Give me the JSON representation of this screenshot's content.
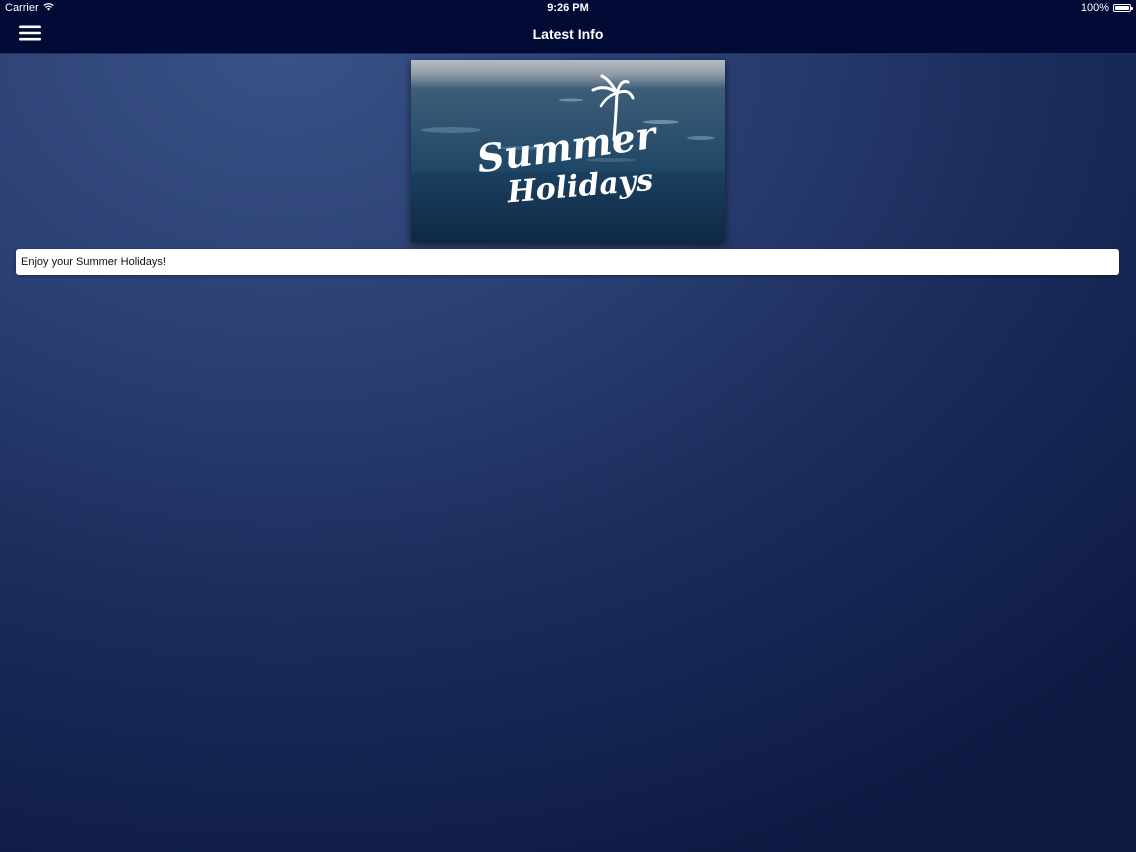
{
  "status_bar": {
    "carrier": "Carrier",
    "time": "9:26 PM",
    "battery": "100%",
    "battery_level": 1.0
  },
  "nav": {
    "title": "Latest Info",
    "menu_icon": "hamburger-menu-icon"
  },
  "banner": {
    "logo_text_line1": "Summer",
    "logo_text_line2": "Holidays",
    "logo_icon": "palm-tree-icon"
  },
  "info": {
    "message": "Enjoy your Summer Holidays!"
  },
  "colors": {
    "nav_background": "#020a36",
    "page_background_top": "#3a5286",
    "page_background_bottom": "#0d1a42",
    "banner_water": "#1d4466"
  }
}
